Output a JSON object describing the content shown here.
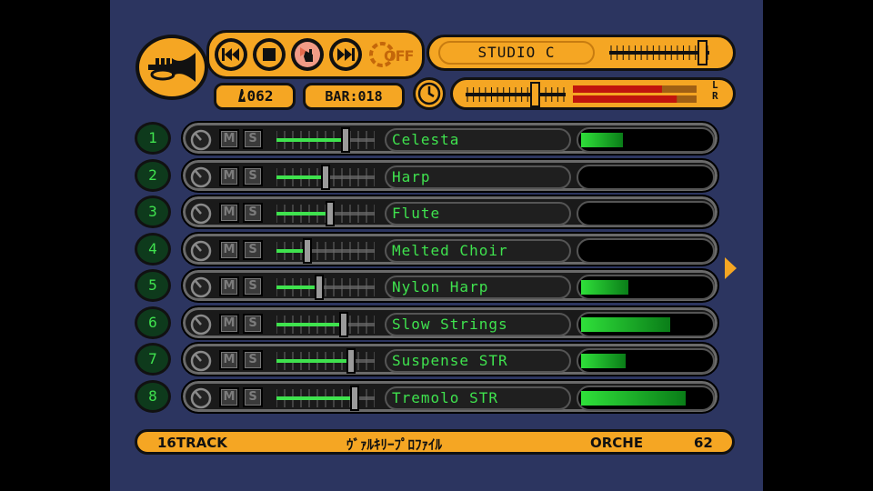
{
  "header": {
    "studio_name": "STUDIO C",
    "tempo": "062",
    "bar": "BAR:018",
    "metronome_label": "OFF",
    "master_lr": [
      "L",
      "R"
    ],
    "studio_level": 0.98,
    "master_volume": 0.72,
    "master_meter": {
      "left": 0.72,
      "right": 0.84
    }
  },
  "tracks": [
    {
      "number": "1",
      "name": "Celesta",
      "volume": 0.72,
      "level": 0.32
    },
    {
      "number": "2",
      "name": "Harp",
      "volume": 0.5,
      "level": 0.0
    },
    {
      "number": "3",
      "name": "Flute",
      "volume": 0.55,
      "level": 0.0
    },
    {
      "number": "4",
      "name": "Melted Choir",
      "volume": 0.3,
      "level": 0.0
    },
    {
      "number": "5",
      "name": "Nylon Harp",
      "volume": 0.43,
      "level": 0.36
    },
    {
      "number": "6",
      "name": "Slow Strings",
      "volume": 0.7,
      "level": 0.68
    },
    {
      "number": "7",
      "name": "Suspense STR",
      "volume": 0.78,
      "level": 0.34
    },
    {
      "number": "8",
      "name": "Tremolo STR",
      "volume": 0.82,
      "level": 0.8
    }
  ],
  "track_buttons": {
    "mute": "M",
    "solo": "S"
  },
  "status": {
    "tracks": "16TRACK",
    "song": "ｳﾞｧﾙｷﾘｰﾌﾟﾛﾌｧｲﾙ",
    "category": "ORCHE",
    "number": "62"
  },
  "colors": {
    "panel": "#f5a623",
    "background": "#2c3560",
    "lcd_green": "#3fe24e",
    "meter_red": "#c0150d"
  },
  "icons": {
    "instrument": "trumpet-icon",
    "rewind": "rewind-icon",
    "stop": "stop-icon",
    "play": "play-icon",
    "forward": "fast-forward-icon",
    "metronome": "metronome-icon",
    "clock": "clock-icon",
    "knob": "pan-knob-icon"
  }
}
